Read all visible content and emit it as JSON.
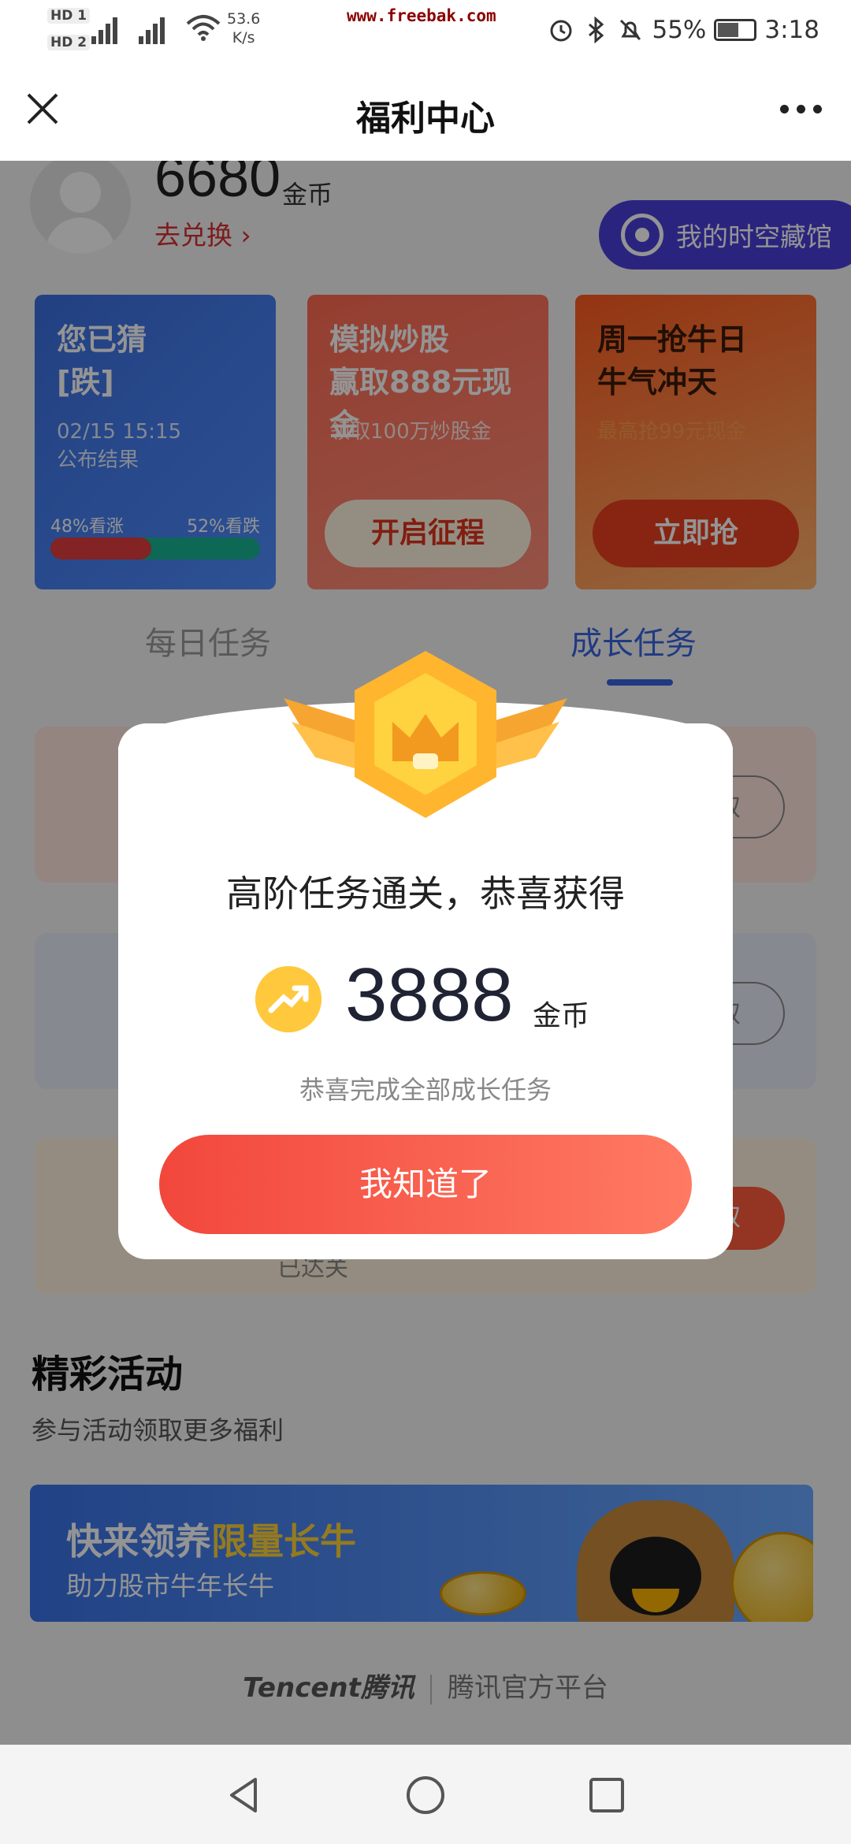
{
  "status_bar": {
    "hd1": "HD 1",
    "hd2": "HD 2",
    "signal1": "4G",
    "signal2": "4G",
    "net_speed": "53.6",
    "net_unit": "K/s",
    "watermark": "www.freebak.com",
    "battery": "55%",
    "time": "3:18"
  },
  "nav": {
    "title": "福利中心"
  },
  "profile": {
    "coins": "6680",
    "coins_unit": "金币",
    "exchange": "去兑换",
    "museum": "我的时空藏馆"
  },
  "cards": [
    {
      "title": "您已猜",
      "title2": "[跌]",
      "sub1": "02/15 15:15",
      "sub2": "公布结果",
      "up_label": "48%看涨",
      "down_label": "52%看跌",
      "up_fraction": 0.48
    },
    {
      "title": "模拟炒股",
      "title2": "赢取888元现金",
      "sub1": "领取100万炒股金",
      "button": "开启征程"
    },
    {
      "title": "周一抢牛日",
      "title2": "牛气冲天",
      "sub1": "最高抢99元现金",
      "button": "立即抢"
    }
  ],
  "tabs": {
    "daily": "每日任务",
    "growth": "成长任务"
  },
  "tasks": [
    {
      "button": "领取"
    },
    {
      "button": "领取"
    },
    {
      "sub": "已达关",
      "button": "领取"
    }
  ],
  "activities": {
    "title": "精彩活动",
    "subtitle": "参与活动领取更多福利",
    "banner_title_a": "快来领养",
    "banner_title_b": "限量长牛",
    "banner_sub": "助力股市牛年长牛"
  },
  "footer": {
    "brand_en": "Tencent",
    "brand_cn": "腾讯",
    "platform": "腾讯官方平台"
  },
  "modal": {
    "title": "高阶任务通关，恭喜获得",
    "amount": "3888",
    "unit": "金币",
    "desc": "恭喜完成全部成长任务",
    "button": "我知道了"
  },
  "colors": {
    "accent_red": "#f2473c",
    "accent_blue": "#3765e0",
    "museum_purple": "#4a3fd9",
    "coin_yellow": "#ffc83d"
  }
}
